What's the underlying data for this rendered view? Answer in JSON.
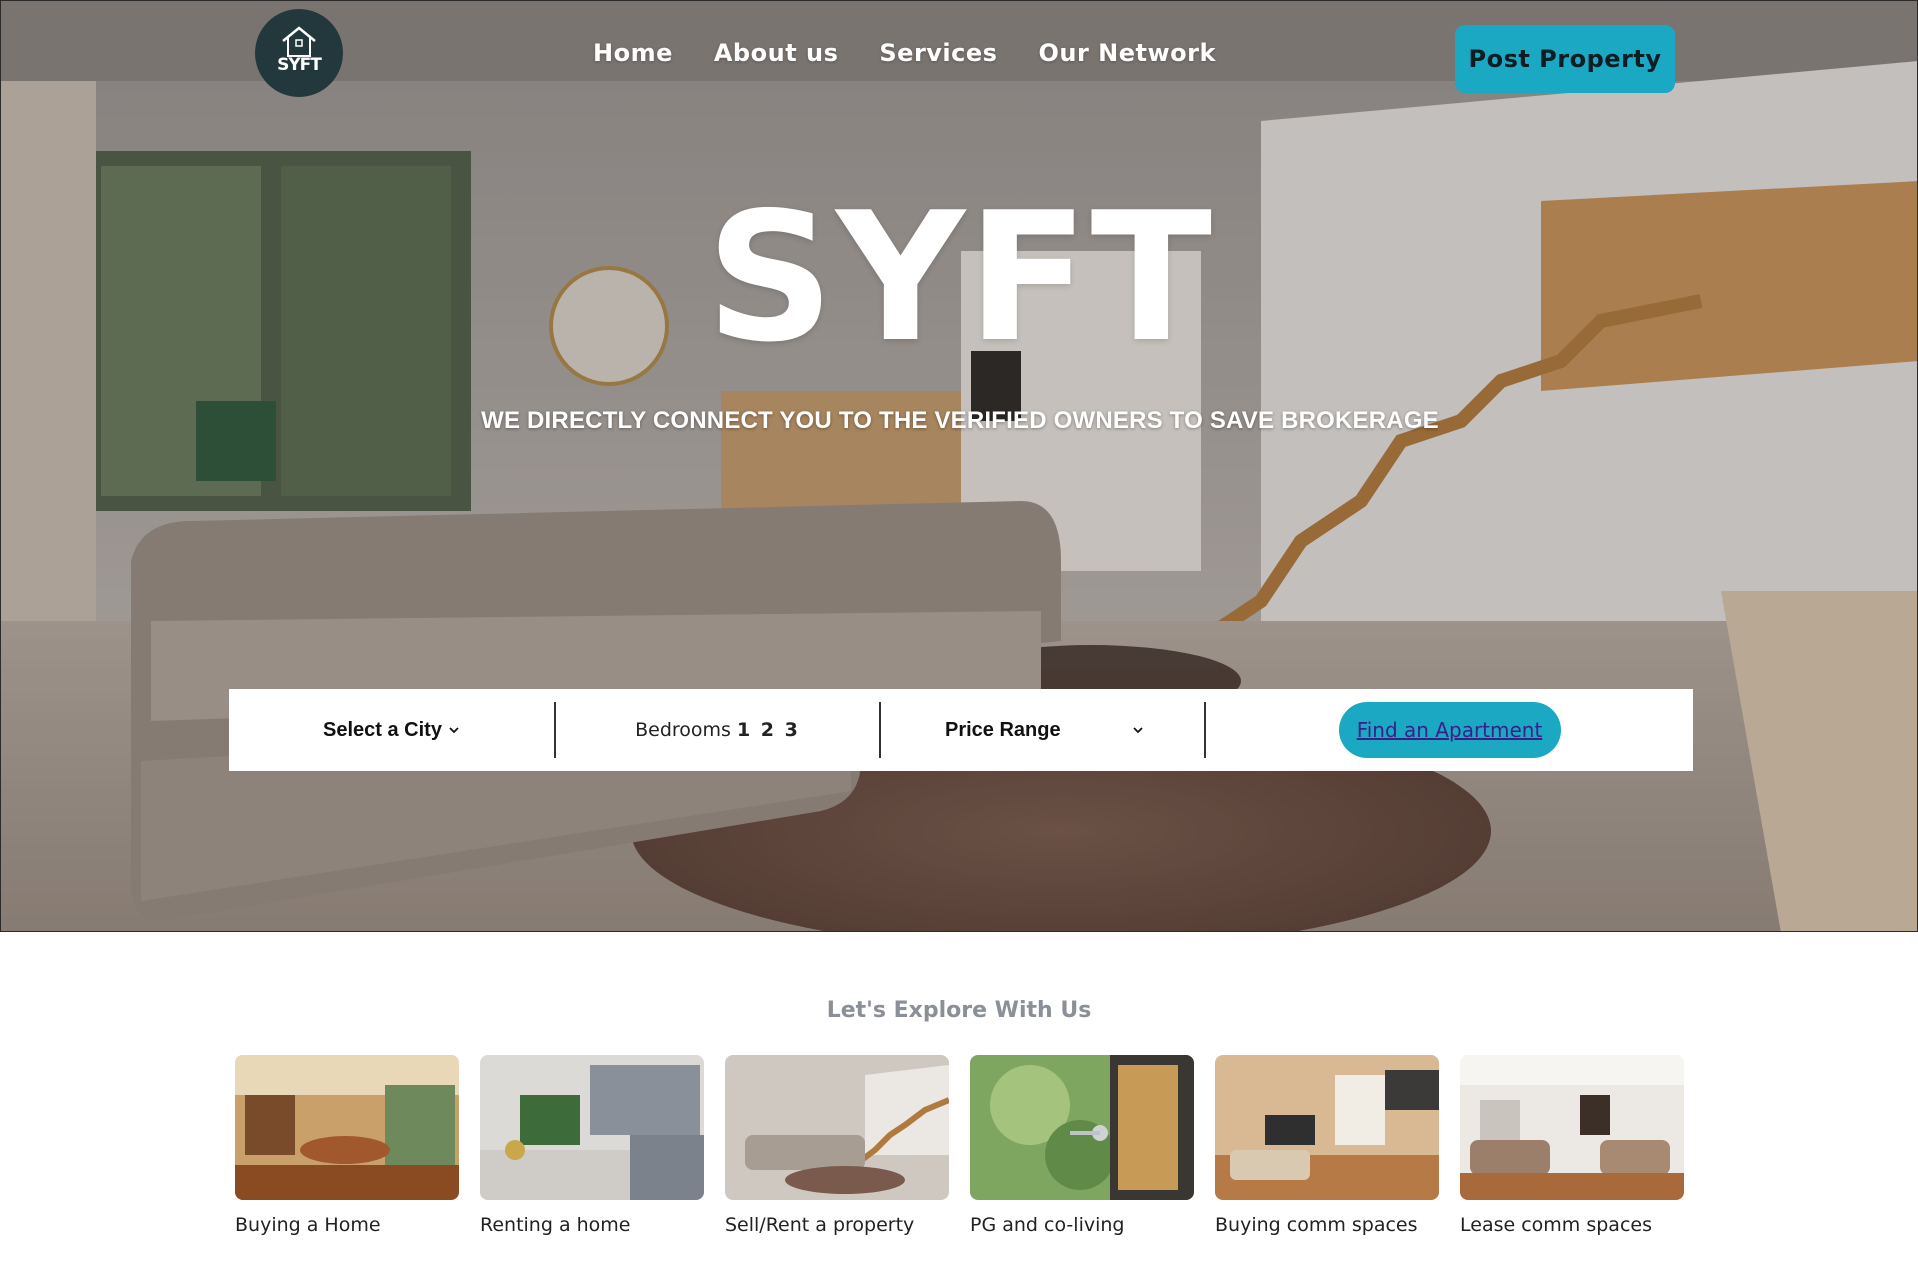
{
  "header": {
    "logo_text": "SYFT",
    "nav": [
      {
        "label": "Home"
      },
      {
        "label": "About us"
      },
      {
        "label": "Services"
      },
      {
        "label": "Our Network"
      }
    ],
    "post_property_label": "Post Property"
  },
  "hero": {
    "title": "SYFT",
    "tagline": "WE DIRECTLY CONNECT YOU TO THE VERIFIED OWNERS TO SAVE BROKERAGE"
  },
  "search": {
    "city_label": "Select a City",
    "bedrooms_label": "Bedrooms",
    "bedroom_options": "1 2 3",
    "price_label": "Price Range",
    "find_label": "Find an Apartment"
  },
  "explore": {
    "title": "Let's Explore With Us",
    "cards": [
      {
        "label": "Buying a Home"
      },
      {
        "label": "Renting a home"
      },
      {
        "label": "Sell/Rent a property"
      },
      {
        "label": "PG and co-living"
      },
      {
        "label": "Buying comm spaces"
      },
      {
        "label": "Lease comm spaces"
      }
    ]
  },
  "colors": {
    "accent": "#1ba8c2",
    "logo_bg": "#23383d",
    "muted_heading": "#8a8f98"
  }
}
